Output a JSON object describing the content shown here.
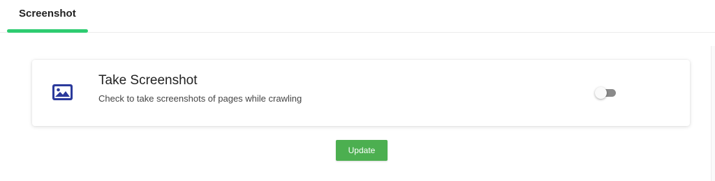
{
  "tabs": {
    "items": [
      {
        "label": "Screenshot",
        "active": true
      }
    ],
    "indicator_color": "#2ecc71"
  },
  "setting": {
    "icon": "image-icon",
    "icon_color": "#2b3a9c",
    "title": "Take Screenshot",
    "description": "Check to take screenshots of pages while crawling",
    "toggle_enabled": false
  },
  "actions": {
    "update_label": "Update",
    "update_color": "#4caf50"
  }
}
